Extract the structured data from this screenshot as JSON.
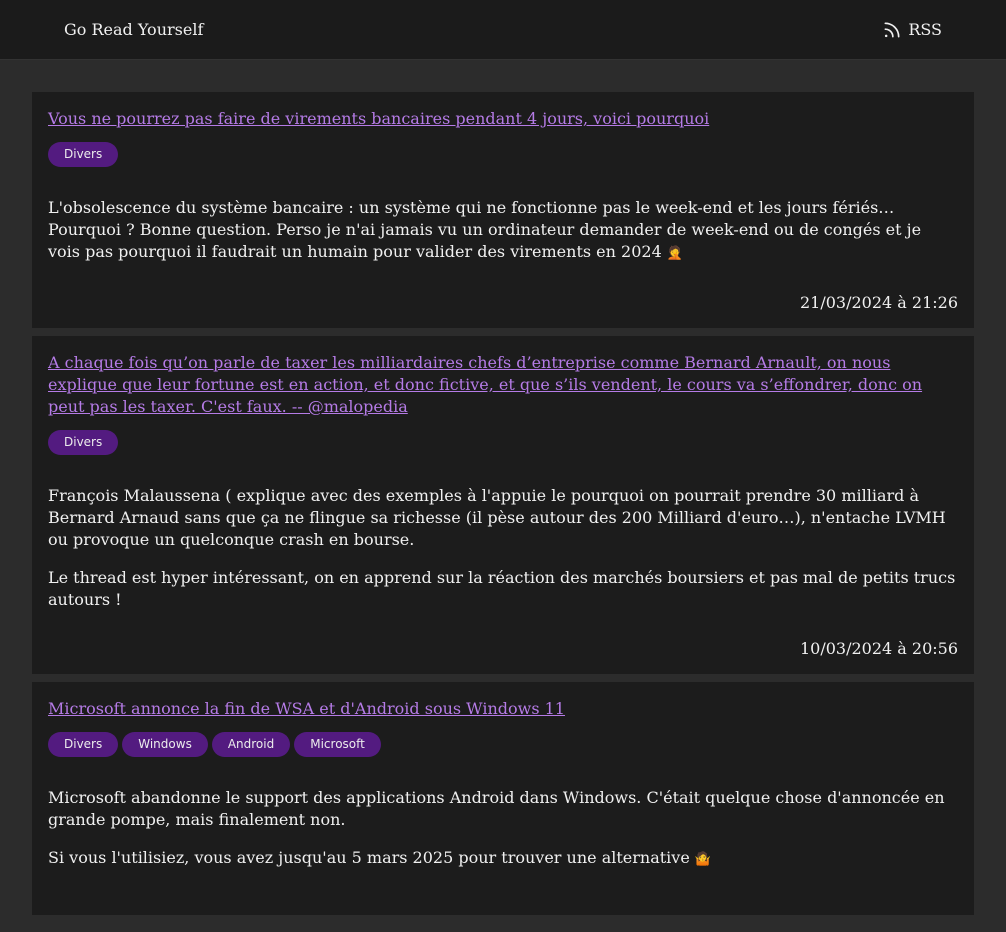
{
  "header": {
    "brand": "Go Read Yourself",
    "rss_label": "RSS",
    "rss_icon": "rss-icon"
  },
  "posts": [
    {
      "title": "Vous ne pourrez pas faire de virements bancaires pendant 4 jours, voici pourquoi",
      "tags": [
        "Divers"
      ],
      "paragraphs": [
        "L'obsolescence du système bancaire : un système qui ne fonctionne pas le week-end et les jours fériés… Pourquoi ? Bonne question. Perso je n'ai jamais vu un ordinateur demander de week-end ou de congés et je vois pas pourquoi il faudrait un humain pour valider des virements en 2024"
      ],
      "emoji": "🤦",
      "date": "21/03/2024 à 21:26"
    },
    {
      "title": "A chaque fois qu’on parle de taxer les milliardaires chefs d’entreprise comme Bernard Arnault, on nous explique que leur fortune est en action, et donc fictive, et que s’ils vendent, le cours va s’effondrer, donc on peut pas les taxer. C'est faux. -- @malopedia",
      "tags": [
        "Divers"
      ],
      "paragraphs": [
        "François Malaussena ( explique avec des exemples à l'appuie le pourquoi on pourrait prendre 30 milliard à Bernard Arnaud sans que ça ne flingue sa richesse (il pèse autour des 200 Milliard d'euro…), n'entache LVMH ou provoque un quelconque crash en bourse.",
        "Le thread est hyper intéressant, on en apprend sur la réaction des marchés boursiers et pas mal de petits trucs autours !"
      ],
      "date": "10/03/2024 à 20:56"
    },
    {
      "title": "Microsoft annonce la fin de WSA et d'Android sous Windows 11",
      "tags": [
        "Divers",
        "Windows",
        "Android",
        "Microsoft"
      ],
      "paragraphs": [
        "Microsoft abandonne le support des applications Android dans Windows. C'était quelque chose d'annoncée en grande pompe, mais finalement non.",
        "Si vous l'utilisiez, vous avez jusqu'au 5 mars 2025 pour trouver une alternative"
      ],
      "emoji": "🤷",
      "date": ""
    }
  ]
}
